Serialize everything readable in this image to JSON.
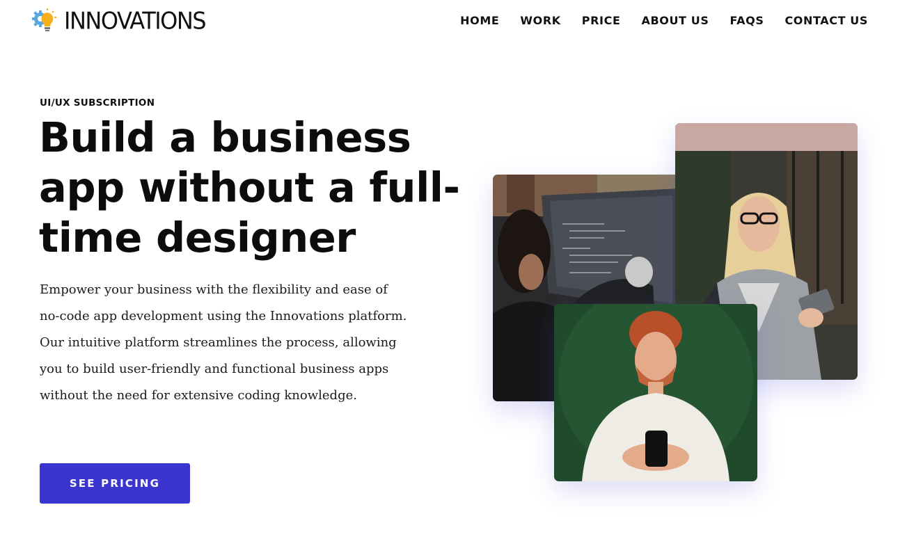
{
  "brand": {
    "name": "INNOVATIONS",
    "logo_icon": "lightbulb-gear-icon",
    "accent_color": "#3a35cf"
  },
  "nav": {
    "items": [
      {
        "label": "HOME"
      },
      {
        "label": "WORK"
      },
      {
        "label": "PRICE"
      },
      {
        "label": "ABOUT US"
      },
      {
        "label": "FAQS"
      },
      {
        "label": "CONTACT US"
      }
    ]
  },
  "hero": {
    "eyebrow": "UI/UX SUBSCRIPTION",
    "headline": "Build a business app without a full-time designer",
    "description": "Empower your business with the flexibility and ease of no-code app development using the Innovations platform. Our intuitive platform streamlines the process, allowing you to build user-friendly and functional business apps without the need for extensive coding knowledge.",
    "cta_label": "SEE PRICING"
  },
  "images": [
    {
      "name": "people-coding-at-screen"
    },
    {
      "name": "woman-with-glasses-holding-tablet"
    },
    {
      "name": "smiling-man-holding-phone"
    }
  ]
}
